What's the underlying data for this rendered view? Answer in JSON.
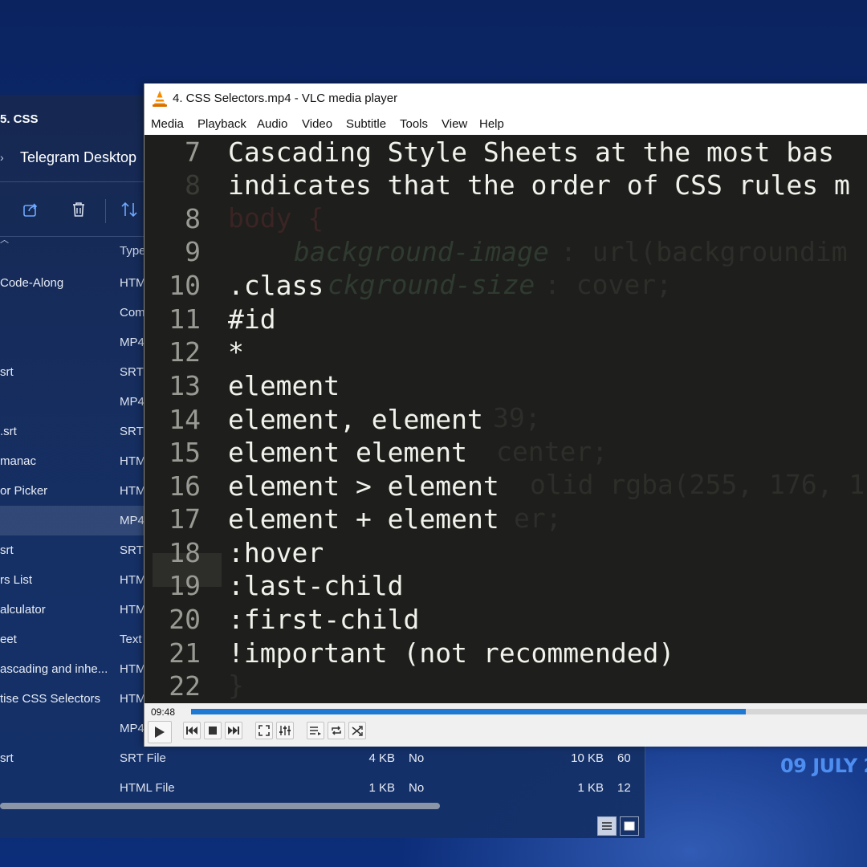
{
  "wallpaper": {
    "date_text": "09 JULY 2"
  },
  "explorer": {
    "title": "5. CSS",
    "tab_label": "Telegram Desktop",
    "toolbar": [
      "share-icon",
      "delete-icon",
      "sort-icon"
    ],
    "column_type_header": "Type",
    "rows": [
      {
        "name": "Code-Along",
        "type": "HTM"
      },
      {
        "name": "",
        "type": "Com"
      },
      {
        "name": "",
        "type": "MP4"
      },
      {
        "name": "srt",
        "type": "SRT"
      },
      {
        "name": "",
        "type": "MP4"
      },
      {
        "name": ".srt",
        "type": "SRT"
      },
      {
        "name": "manac",
        "type": "HTM"
      },
      {
        "name": "or Picker",
        "type": "HTM"
      },
      {
        "name": "",
        "type": "MP4"
      },
      {
        "name": "srt",
        "type": "SRT"
      },
      {
        "name": "rs List",
        "type": "HTM"
      },
      {
        "name": "alculator",
        "type": "HTM"
      },
      {
        "name": "eet",
        "type": "Text"
      },
      {
        "name": "ascading and inhe...",
        "type": "HTM"
      },
      {
        "name": "tise CSS Selectors",
        "type": "HTM"
      },
      {
        "name": "",
        "type": "MP4"
      },
      {
        "name": "srt",
        "type": "SRT File",
        "size": "4 KB",
        "flag": "No",
        "size2": "10 KB",
        "extra": "60"
      },
      {
        "name": "",
        "type": "HTML File",
        "size": "1 KB",
        "flag": "No",
        "size2": "1 KB",
        "extra": "12"
      }
    ],
    "selected_index": 8
  },
  "vlc": {
    "title": "4. CSS Selectors.mp4 - VLC media player",
    "menu": [
      "Media",
      "Playback",
      "Audio",
      "Video",
      "Subtitle",
      "Tools",
      "View",
      "Help"
    ],
    "current_time": "09:48",
    "progress_fraction": 0.82,
    "video": {
      "line_numbers": [
        "7",
        "8",
        "8",
        "9",
        "10",
        "11",
        "12",
        "13",
        "14",
        "15",
        "16",
        "17",
        "18",
        "19",
        "20",
        "21",
        "22"
      ],
      "code_lines": [
        "Cascading Style Sheets at the most bas",
        "indicates that the order of CSS rules m",
        "",
        "",
        ".class",
        "#id",
        "*",
        "element",
        "element, element",
        "element element",
        "element > element",
        "element + element",
        ":hover",
        ":last-child",
        ":first-child",
        "!important (not recommended)",
        ""
      ],
      "ghost_text": {
        "body": "body {",
        "bg_image_prop": "background-image",
        "bg_image_val": ": url(backgroundim",
        "bg_size": "ckground-size",
        "bg_size_val": ": cover;",
        "l14": "39;",
        "l15": "center;",
        "l16": "olid rgba(255, 176, 1",
        "l17": "er;",
        "brace": "}"
      }
    }
  },
  "colors": {
    "seek_fill": "#1f78d1",
    "wallpaper_date": "#4d8ef0",
    "code_bg": "#1e1e1c"
  }
}
